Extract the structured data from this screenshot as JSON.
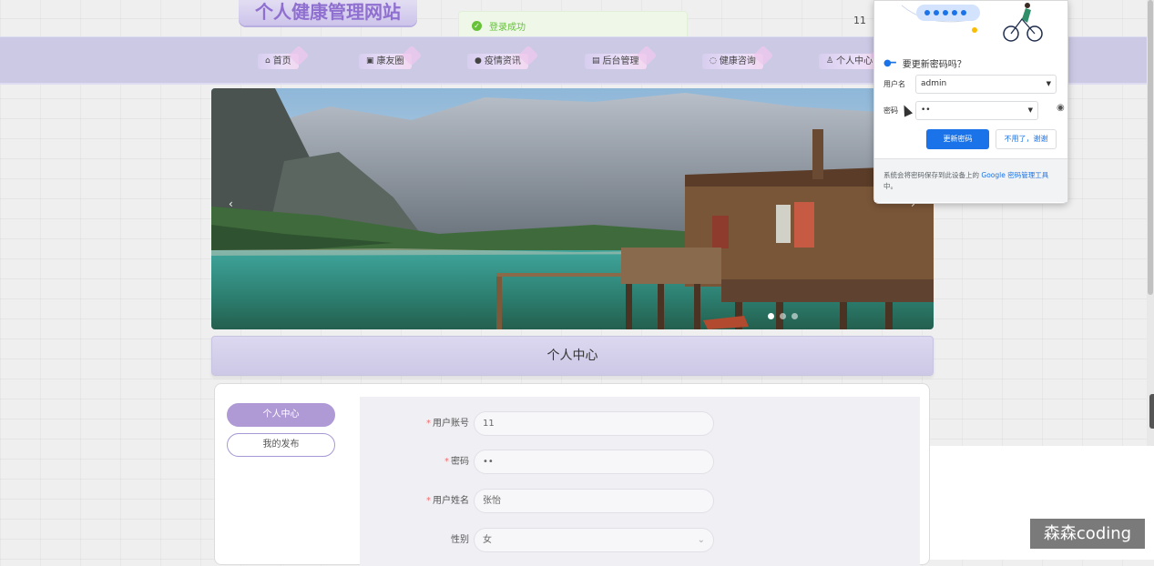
{
  "header": {
    "site_title": "个人健康管理网站",
    "user_name": "11"
  },
  "toast": {
    "message": "登录成功",
    "icon": "check-circle-icon",
    "color": "#67c23a"
  },
  "nav": {
    "items": [
      {
        "label": "首页",
        "icon": "home-icon"
      },
      {
        "label": "康友圈",
        "icon": "bag-icon"
      },
      {
        "label": "疫情资讯",
        "icon": "info-icon"
      },
      {
        "label": "后台管理",
        "icon": "admin-icon"
      },
      {
        "label": "健康咨询",
        "icon": "consult-icon"
      },
      {
        "label": "个人中心",
        "icon": "user-icon"
      }
    ]
  },
  "carousel": {
    "slide_count": 3,
    "active_index": 0,
    "prev_icon": "chevron-left-icon",
    "next_icon": "chevron-right-icon"
  },
  "section": {
    "title": "个人中心"
  },
  "sidebar": {
    "items": [
      {
        "label": "个人中心",
        "active": true
      },
      {
        "label": "我的发布",
        "active": false
      }
    ]
  },
  "form": {
    "fields": [
      {
        "label": "用户账号",
        "required": true,
        "value": "11"
      },
      {
        "label": "密码",
        "required": true,
        "value": "••"
      },
      {
        "label": "用户姓名",
        "required": true,
        "value": "张怡"
      },
      {
        "label": "性别",
        "required": false,
        "value": "女"
      }
    ]
  },
  "password_popup": {
    "title": "要更新密码吗？",
    "username_label": "用户名",
    "username_value": "admin",
    "password_label": "密码",
    "password_value": "••",
    "update_button": "更新密码",
    "dismiss_button": "不用了，谢谢",
    "footer_text": "系统会将密码保存到此设备上的",
    "footer_link": "Google 密码管理工具",
    "footer_end": "中。",
    "accent": "#1a73e8"
  },
  "watermark": {
    "text": "森森coding"
  },
  "colors": {
    "nav_bg": "#cbc9e4",
    "accent_purple": "#b09ad6",
    "required": "#f56c6c"
  }
}
